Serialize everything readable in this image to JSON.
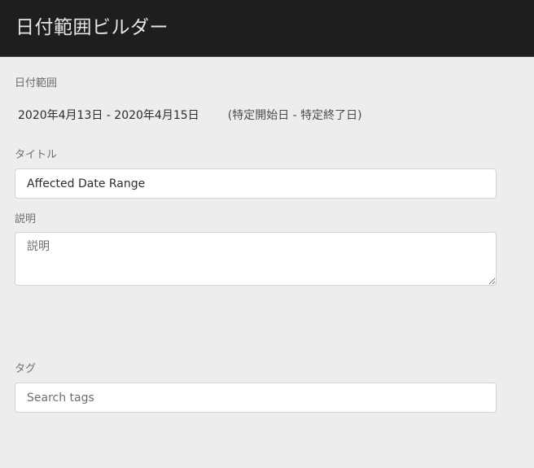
{
  "header": {
    "title": "日付範囲ビルダー"
  },
  "date_range": {
    "label": "日付範囲",
    "value": "2020年4月13日 - 2020年4月15日",
    "type": "(特定開始日 - 特定終了日)"
  },
  "title_field": {
    "label": "タイトル",
    "value": "Affected Date Range"
  },
  "description_field": {
    "label": "説明",
    "placeholder": "説明"
  },
  "tags_field": {
    "label": "タグ",
    "placeholder": "Search tags"
  }
}
